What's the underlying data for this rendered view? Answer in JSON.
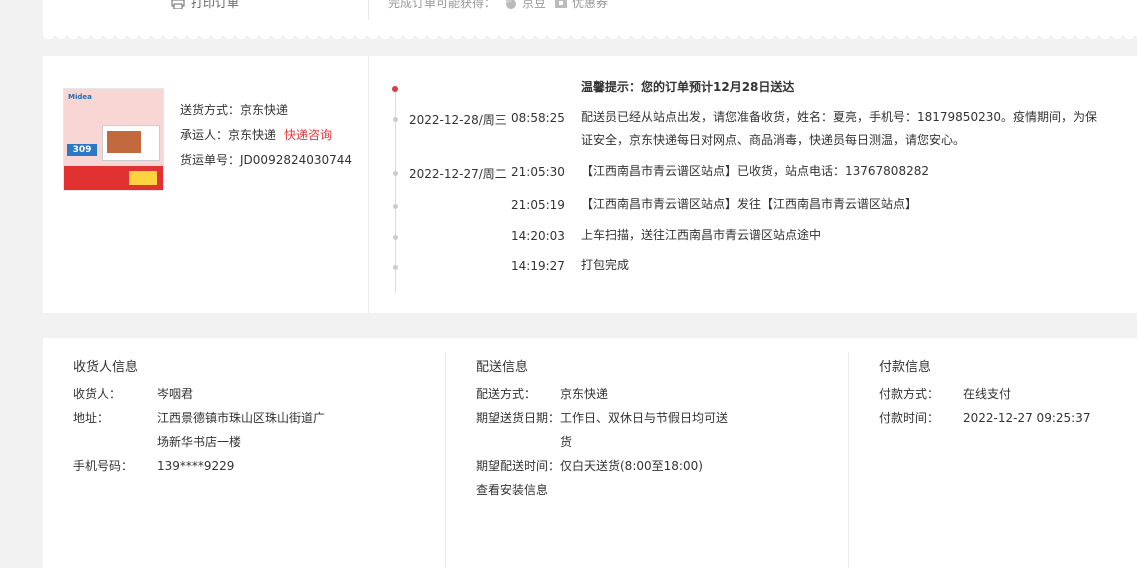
{
  "top": {
    "print_label": "打印订单",
    "gain_prefix": "完成订单可能获得：",
    "gain_items": [
      "京豆",
      "优惠券"
    ]
  },
  "shipping": {
    "product_thumb": {
      "brand": "Midea",
      "price": "309"
    },
    "method_label": "送货方式：",
    "method_value": "京东快递",
    "carrier_label": "承运人：",
    "carrier_value": "京东快递",
    "carrier_link": "快递咨询",
    "waybill_label": "货运单号：",
    "waybill_value": "JD0092824030744"
  },
  "timeline": [
    {
      "date": "",
      "time": "",
      "text": "温馨提示：您的订单预计12月28日送达",
      "bold": true,
      "active": true
    },
    {
      "date": "2022-12-28/周三",
      "time": "08:58:25",
      "text": "配送员已经从站点出发，请您准备收货，姓名：夏亮，手机号：18179850230。疫情期间，为保证安全，京东快递每日对网点、商品消毒，快递员每日测温，请您安心。"
    },
    {
      "date": "2022-12-27/周二",
      "time": "21:05:30",
      "text": "【江西南昌市青云谱区站点】已收货，站点电话：13767808282"
    },
    {
      "date": "",
      "time": "21:05:19",
      "text": "【江西南昌市青云谱区站点】发往【江西南昌市青云谱区站点】"
    },
    {
      "date": "",
      "time": "14:20:03",
      "text": "上车扫描，送往江西南昌市青云谱区站点途中"
    },
    {
      "date": "",
      "time": "14:19:27",
      "text": "打包完成"
    }
  ],
  "receiver": {
    "title": "收货人信息",
    "name_label": "收货人：",
    "name_value": "岑咽君",
    "addr_label": "地址：",
    "addr_value": "江西景德镇市珠山区珠山街道广场新华书店一楼",
    "phone_label": "手机号码：",
    "phone_value": "139****9229"
  },
  "delivery": {
    "title": "配送信息",
    "method_label": "配送方式：",
    "method_value": "京东快递",
    "date_label": "期望送货日期：",
    "date_value": "工作日、双休日与节假日均可送货",
    "time_label": "期望配送时间：",
    "time_value": "仅白天送货(8:00至18:00)",
    "install_link": "查看安装信息"
  },
  "payment": {
    "title": "付款信息",
    "method_label": "付款方式：",
    "method_value": "在线支付",
    "time_label": "付款时间：",
    "time_value": "2022-12-27 09:25:37"
  },
  "colors": {
    "accent_red": "#e4393c",
    "panel_bg": "#ffffff",
    "page_bg": "#f2f2f2"
  }
}
